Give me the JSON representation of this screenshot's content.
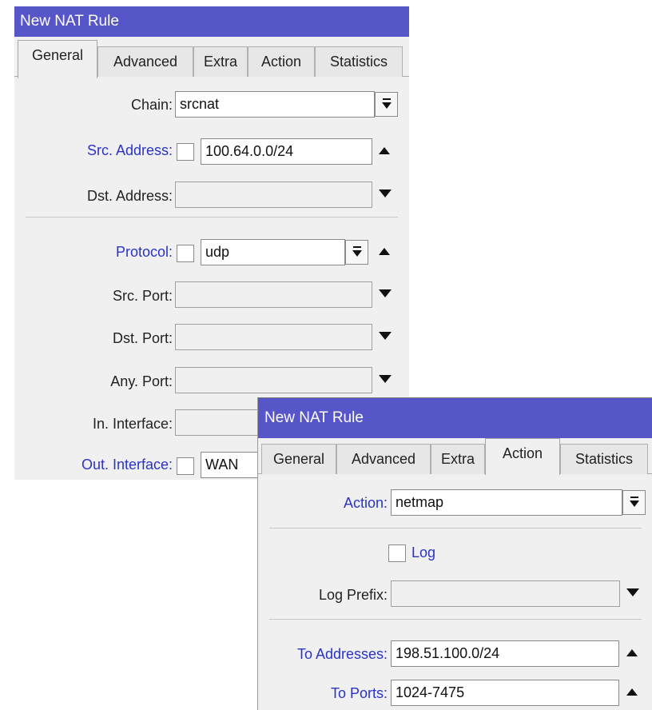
{
  "window1": {
    "title": "New NAT Rule",
    "tabs": [
      "General",
      "Advanced",
      "Extra",
      "Action",
      "Statistics"
    ],
    "active_tab": "General",
    "fields": {
      "chain": {
        "label": "Chain:",
        "value": "srcnat"
      },
      "src_address": {
        "label": "Src. Address:",
        "value": "100.64.0.0/24"
      },
      "dst_address": {
        "label": "Dst. Address:",
        "value": ""
      },
      "protocol": {
        "label": "Protocol:",
        "value": "udp"
      },
      "src_port": {
        "label": "Src. Port:",
        "value": ""
      },
      "dst_port": {
        "label": "Dst. Port:",
        "value": ""
      },
      "any_port": {
        "label": "Any. Port:",
        "value": ""
      },
      "in_interface": {
        "label": "In. Interface:",
        "value": ""
      },
      "out_interface": {
        "label": "Out. Interface:",
        "value": "WAN"
      }
    }
  },
  "window2": {
    "title": "New NAT Rule",
    "tabs": [
      "General",
      "Advanced",
      "Extra",
      "Action",
      "Statistics"
    ],
    "active_tab": "Action",
    "fields": {
      "action": {
        "label": "Action:",
        "value": "netmap"
      },
      "log": {
        "label": "Log",
        "checked": false
      },
      "log_prefix": {
        "label": "Log Prefix:",
        "value": ""
      },
      "to_addresses": {
        "label": "To Addresses:",
        "value": "198.51.100.0/24"
      },
      "to_ports": {
        "label": "To Ports:",
        "value": "1024-7475"
      }
    }
  },
  "colors": {
    "titlebar": "#5656c8",
    "label_highlight": "#2a33c4"
  },
  "icons": [
    "dropdown-icon",
    "arrow-up-icon",
    "arrow-down-icon"
  ]
}
